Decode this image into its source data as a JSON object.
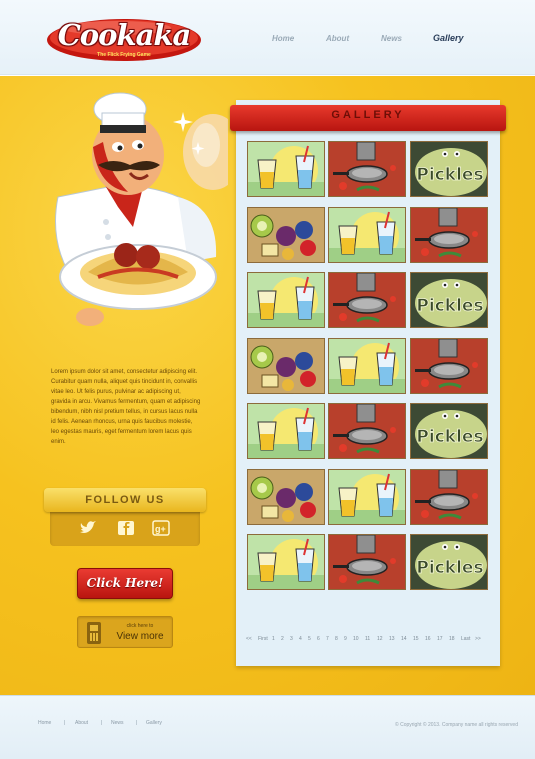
{
  "logo": {
    "name": "Cookaka",
    "tagline": "The Flick Frying Game"
  },
  "nav": [
    "Home",
    "About",
    "News",
    "Gallery"
  ],
  "nav_active": "Gallery",
  "sidebar": {
    "lorem": "Lorem ipsum dolor sit amet, consectetur adipiscing elit. Curabitur quam nulla, aliquet quis tincidunt in, convallis vitae leo. Ut felis purus, pulvinar ac adipiscing ut, gravida in arcu. Vivamus fermentum, quam et adipiscing bibendum, nibh nisl pretium tellus, in cursus lacus nulla id felis. Aenean rhoncus, urna quis faucibus molestie, leo egestas mauris, eget fermentum lorem lacus quis enim.",
    "follow_title": "FOLLOW US",
    "social_icons": [
      "twitter-icon",
      "facebook-icon",
      "google-plus-icon"
    ],
    "click_label": "Click Here!",
    "view_small": "click here to",
    "view_big": "View more"
  },
  "gallery": {
    "title": "GALLERY",
    "thumbs": [
      [
        "drinks",
        "pan",
        "pickles"
      ],
      [
        "fruits",
        "drinks",
        "pan"
      ],
      [
        "drinks",
        "pan",
        "pickles"
      ],
      [
        "fruits",
        "drinks",
        "pan"
      ],
      [
        "drinks",
        "pan",
        "pickles"
      ],
      [
        "fruits",
        "drinks",
        "pan"
      ],
      [
        "drinks",
        "pan",
        "pickles"
      ]
    ],
    "pickles_text": "Pickles",
    "pagination": [
      "<<",
      "First",
      "1",
      "2",
      "3",
      "4",
      "5",
      "6",
      "7",
      "8",
      "9",
      "10",
      "11",
      "12",
      "13",
      "14",
      "15",
      "16",
      "17",
      "18",
      "Last",
      ">>"
    ]
  },
  "footer": {
    "links": [
      "Home",
      "About",
      "News",
      "Gallery"
    ],
    "separator": "|",
    "copyright": "© Copyright © 2013. Company name all rights reserved"
  },
  "colors": {
    "yellow": "#f6c21f",
    "red": "#d42a1f",
    "panel": "#e3f0f8",
    "header": "#eef6fb"
  }
}
